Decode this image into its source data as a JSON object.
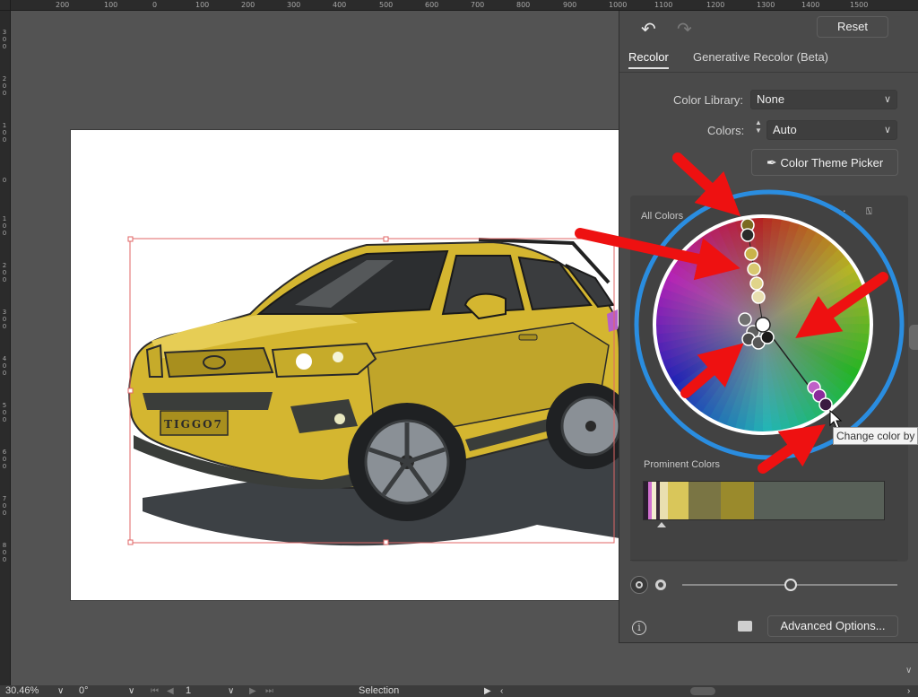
{
  "rulers": {
    "top_ticks": [
      "200",
      "100",
      "0",
      "100",
      "200",
      "300",
      "400",
      "500",
      "600",
      "700",
      "800",
      "900",
      "1000",
      "1100",
      "1200",
      "1300",
      "1400",
      "1500"
    ],
    "left_ticks": [
      "3\n0\n0",
      "2\n0\n0",
      "1\n0\n0",
      "0",
      "1\n0\n0",
      "2\n0\n0",
      "3\n0\n0",
      "4\n0\n0",
      "5\n0\n0",
      "6\n0\n0",
      "7\n0\n0",
      "8\n0\n0"
    ]
  },
  "artwork": {
    "plate_text": "TIGGO7",
    "colors": {
      "body": "#d4b630",
      "body_shade": "#a88f1e",
      "trim": "#3a3d3a",
      "shadow": "#3d4145",
      "selection": "#e06666"
    }
  },
  "panel": {
    "undo_icon": "undo-icon",
    "redo_icon": "redo-icon",
    "reset_label": "Reset",
    "tabs": [
      {
        "label": "Recolor",
        "active": true
      },
      {
        "label": "Generative Recolor (Beta)",
        "active": false
      }
    ],
    "color_library": {
      "label": "Color Library:",
      "value": "None"
    },
    "colors": {
      "label": "Colors:",
      "value": "Auto"
    },
    "theme_picker_label": "Color Theme Picker",
    "all_colors_label": "All Colors",
    "prominent_label": "Prominent Colors",
    "prominent_swatches": [
      {
        "color": "#2a1e2e",
        "weight": 1
      },
      {
        "color": "#d070d0",
        "weight": 1
      },
      {
        "color": "#f3ecd0",
        "weight": 1
      },
      {
        "color": "#3a2a3a",
        "weight": 1
      },
      {
        "color": "#e9dfb0",
        "weight": 2
      },
      {
        "color": "#d9c65a",
        "weight": 5
      },
      {
        "color": "#7a7544",
        "weight": 8
      },
      {
        "color": "#9a8a2c",
        "weight": 8
      },
      {
        "color": "#586058",
        "weight": 32
      }
    ],
    "advanced_label": "Advanced Options...",
    "tooltip": "Change color by"
  },
  "status": {
    "zoom": "30.46%",
    "rotation": "0°",
    "artboard_num": "1",
    "tool": "Selection"
  }
}
